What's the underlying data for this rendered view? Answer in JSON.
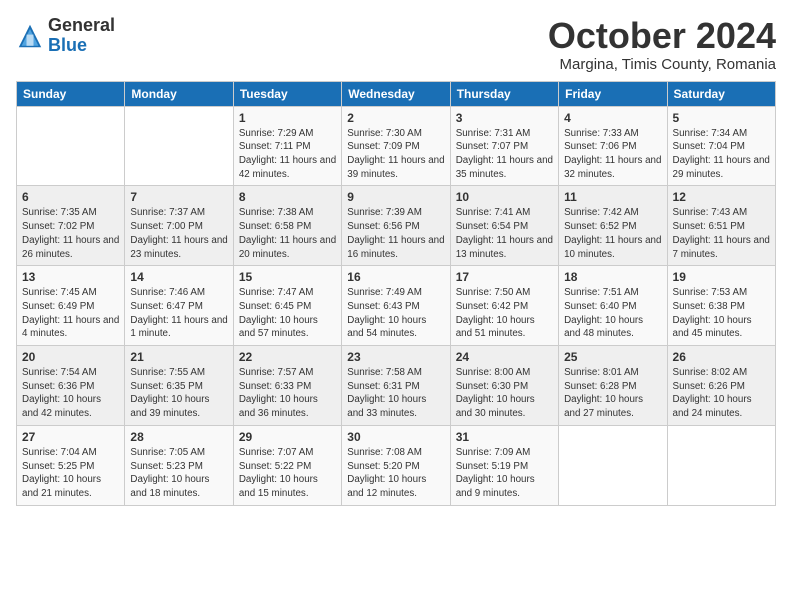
{
  "header": {
    "logo_general": "General",
    "logo_blue": "Blue",
    "month_title": "October 2024",
    "location": "Margina, Timis County, Romania"
  },
  "weekdays": [
    "Sunday",
    "Monday",
    "Tuesday",
    "Wednesday",
    "Thursday",
    "Friday",
    "Saturday"
  ],
  "weeks": [
    [
      {
        "day": "",
        "info": ""
      },
      {
        "day": "",
        "info": ""
      },
      {
        "day": "1",
        "info": "Sunrise: 7:29 AM\nSunset: 7:11 PM\nDaylight: 11 hours and 42 minutes."
      },
      {
        "day": "2",
        "info": "Sunrise: 7:30 AM\nSunset: 7:09 PM\nDaylight: 11 hours and 39 minutes."
      },
      {
        "day": "3",
        "info": "Sunrise: 7:31 AM\nSunset: 7:07 PM\nDaylight: 11 hours and 35 minutes."
      },
      {
        "day": "4",
        "info": "Sunrise: 7:33 AM\nSunset: 7:06 PM\nDaylight: 11 hours and 32 minutes."
      },
      {
        "day": "5",
        "info": "Sunrise: 7:34 AM\nSunset: 7:04 PM\nDaylight: 11 hours and 29 minutes."
      }
    ],
    [
      {
        "day": "6",
        "info": "Sunrise: 7:35 AM\nSunset: 7:02 PM\nDaylight: 11 hours and 26 minutes."
      },
      {
        "day": "7",
        "info": "Sunrise: 7:37 AM\nSunset: 7:00 PM\nDaylight: 11 hours and 23 minutes."
      },
      {
        "day": "8",
        "info": "Sunrise: 7:38 AM\nSunset: 6:58 PM\nDaylight: 11 hours and 20 minutes."
      },
      {
        "day": "9",
        "info": "Sunrise: 7:39 AM\nSunset: 6:56 PM\nDaylight: 11 hours and 16 minutes."
      },
      {
        "day": "10",
        "info": "Sunrise: 7:41 AM\nSunset: 6:54 PM\nDaylight: 11 hours and 13 minutes."
      },
      {
        "day": "11",
        "info": "Sunrise: 7:42 AM\nSunset: 6:52 PM\nDaylight: 11 hours and 10 minutes."
      },
      {
        "day": "12",
        "info": "Sunrise: 7:43 AM\nSunset: 6:51 PM\nDaylight: 11 hours and 7 minutes."
      }
    ],
    [
      {
        "day": "13",
        "info": "Sunrise: 7:45 AM\nSunset: 6:49 PM\nDaylight: 11 hours and 4 minutes."
      },
      {
        "day": "14",
        "info": "Sunrise: 7:46 AM\nSunset: 6:47 PM\nDaylight: 11 hours and 1 minute."
      },
      {
        "day": "15",
        "info": "Sunrise: 7:47 AM\nSunset: 6:45 PM\nDaylight: 10 hours and 57 minutes."
      },
      {
        "day": "16",
        "info": "Sunrise: 7:49 AM\nSunset: 6:43 PM\nDaylight: 10 hours and 54 minutes."
      },
      {
        "day": "17",
        "info": "Sunrise: 7:50 AM\nSunset: 6:42 PM\nDaylight: 10 hours and 51 minutes."
      },
      {
        "day": "18",
        "info": "Sunrise: 7:51 AM\nSunset: 6:40 PM\nDaylight: 10 hours and 48 minutes."
      },
      {
        "day": "19",
        "info": "Sunrise: 7:53 AM\nSunset: 6:38 PM\nDaylight: 10 hours and 45 minutes."
      }
    ],
    [
      {
        "day": "20",
        "info": "Sunrise: 7:54 AM\nSunset: 6:36 PM\nDaylight: 10 hours and 42 minutes."
      },
      {
        "day": "21",
        "info": "Sunrise: 7:55 AM\nSunset: 6:35 PM\nDaylight: 10 hours and 39 minutes."
      },
      {
        "day": "22",
        "info": "Sunrise: 7:57 AM\nSunset: 6:33 PM\nDaylight: 10 hours and 36 minutes."
      },
      {
        "day": "23",
        "info": "Sunrise: 7:58 AM\nSunset: 6:31 PM\nDaylight: 10 hours and 33 minutes."
      },
      {
        "day": "24",
        "info": "Sunrise: 8:00 AM\nSunset: 6:30 PM\nDaylight: 10 hours and 30 minutes."
      },
      {
        "day": "25",
        "info": "Sunrise: 8:01 AM\nSunset: 6:28 PM\nDaylight: 10 hours and 27 minutes."
      },
      {
        "day": "26",
        "info": "Sunrise: 8:02 AM\nSunset: 6:26 PM\nDaylight: 10 hours and 24 minutes."
      }
    ],
    [
      {
        "day": "27",
        "info": "Sunrise: 7:04 AM\nSunset: 5:25 PM\nDaylight: 10 hours and 21 minutes."
      },
      {
        "day": "28",
        "info": "Sunrise: 7:05 AM\nSunset: 5:23 PM\nDaylight: 10 hours and 18 minutes."
      },
      {
        "day": "29",
        "info": "Sunrise: 7:07 AM\nSunset: 5:22 PM\nDaylight: 10 hours and 15 minutes."
      },
      {
        "day": "30",
        "info": "Sunrise: 7:08 AM\nSunset: 5:20 PM\nDaylight: 10 hours and 12 minutes."
      },
      {
        "day": "31",
        "info": "Sunrise: 7:09 AM\nSunset: 5:19 PM\nDaylight: 10 hours and 9 minutes."
      },
      {
        "day": "",
        "info": ""
      },
      {
        "day": "",
        "info": ""
      }
    ]
  ]
}
